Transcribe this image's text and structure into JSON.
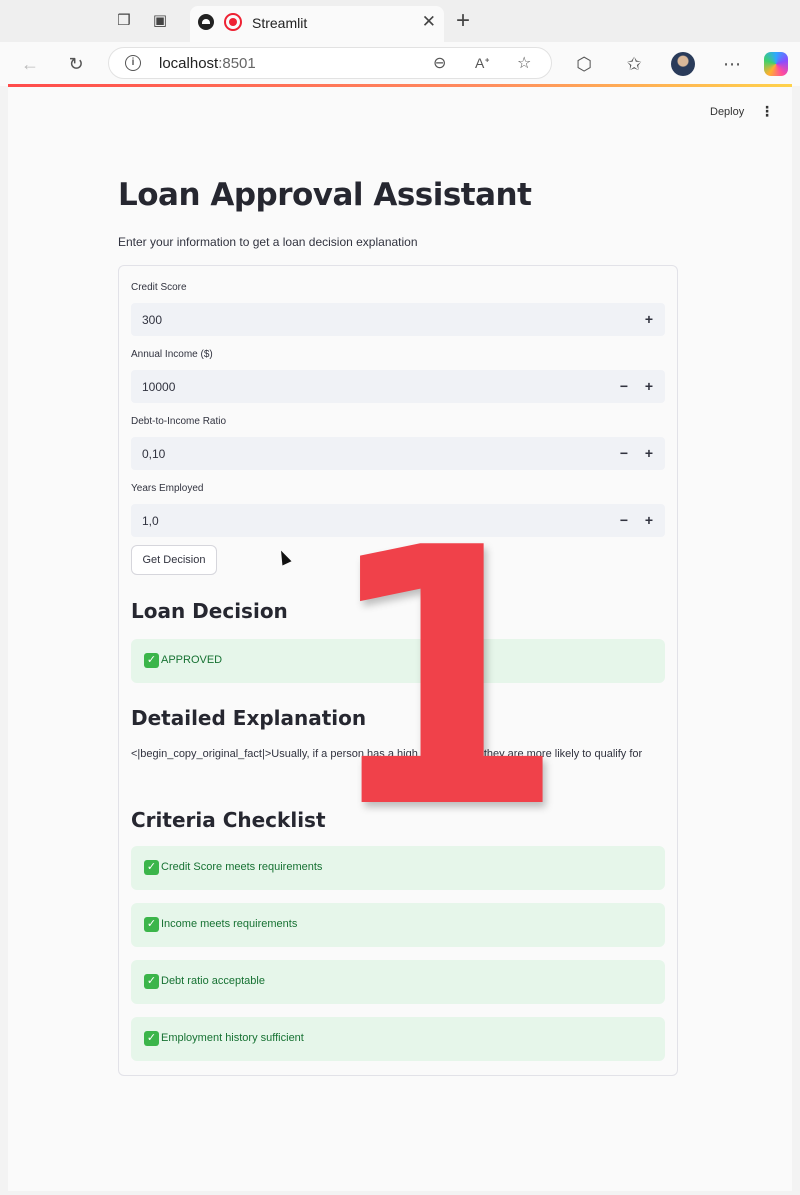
{
  "browser": {
    "tab_title": "Streamlit",
    "url_host": "localhost",
    "url_port": ":8501"
  },
  "header": {
    "deploy_label": "Deploy",
    "menu_glyph": "⋮"
  },
  "app": {
    "title": "Loan Approval Assistant",
    "subtitle": "Enter your information to get a loan decision explanation",
    "fields": [
      {
        "label": "Credit Score",
        "value": "300"
      },
      {
        "label": "Annual Income ($)",
        "value": "10000"
      },
      {
        "label": "Debt-to-Income Ratio",
        "value": "0,10"
      },
      {
        "label": "Years Employed",
        "value": "1,0"
      }
    ],
    "submit_label": "Get Decision",
    "decision_heading": "Loan Decision",
    "decision_text": "APPROVED",
    "explanation_heading": "Detailed Explanation",
    "explanation_text": "<|begin_copy_original_fact|>Usually, if a person has a high credit score, they are more likely to qualify for",
    "checklist_heading": "Criteria Checklist",
    "checklist": [
      "Credit Score meets requirements",
      "Income meets requirements",
      "Debt ratio acceptable",
      "Employment history sufficient"
    ]
  },
  "overlay": {
    "number": "1",
    "color": "#f0414a"
  },
  "colors": {
    "success_bg": "#e6f6ea",
    "success_text": "#177233",
    "accent": "#ff4b4b"
  }
}
